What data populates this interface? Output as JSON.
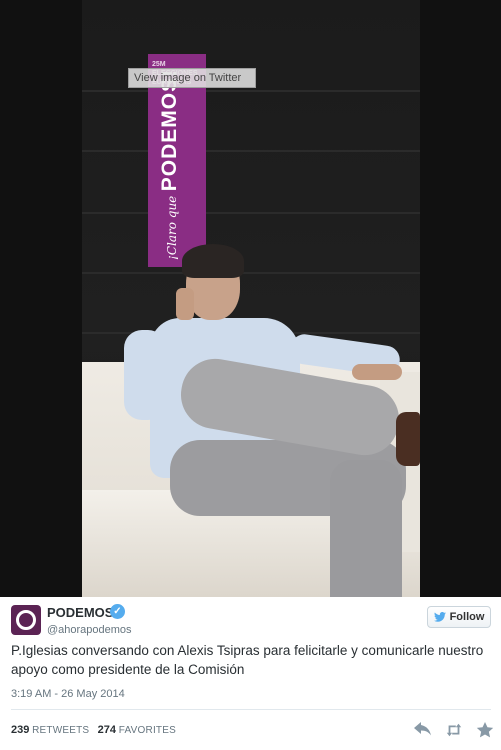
{
  "media": {
    "overlay_label": "View image on Twitter",
    "banner_top_text": "25M ELECCIONES EUROPEAS",
    "banner_script_text": "¡Claro que",
    "banner_main_text": "PODEMOS!"
  },
  "tweet": {
    "display_name": "PODEMOS",
    "verified_mark": "✓",
    "handle": "@ahorapodemos",
    "follow_label": "Follow",
    "text": "P.Iglesias conversando con Alexis Tsipras para felicitarle y comunicarle nuestro apoyo como presidente de la Comisión",
    "timestamp": "3:19 AM - 26 May 2014",
    "retweets_count": "239",
    "retweets_label": "RETWEETS",
    "favorites_count": "274",
    "favorites_label": "FAVORITES"
  },
  "icons": {
    "follow": "twitter-bird-icon",
    "reply": "reply-icon",
    "retweet": "retweet-icon",
    "favorite": "star-icon"
  },
  "colors": {
    "brand_purple": "#8a2d84",
    "avatar_purple": "#5b2354",
    "twitter_blue": "#55acee",
    "text": "#292f33",
    "muted": "#66757f"
  }
}
